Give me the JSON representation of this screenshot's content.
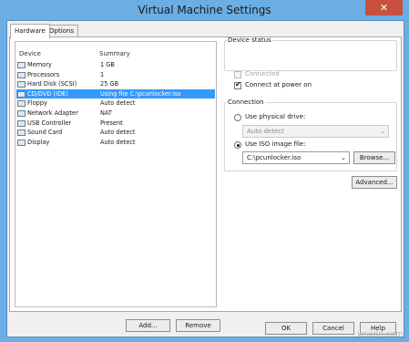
{
  "window": {
    "title": "Virtual Machine Settings",
    "close_glyph": "✕"
  },
  "tabs": [
    {
      "label": "Hardware",
      "active": true
    },
    {
      "label": "Options",
      "active": false
    }
  ],
  "device_list": {
    "headers": {
      "device": "Device",
      "summary": "Summary"
    },
    "rows": [
      {
        "device": "Memory",
        "summary": "1 GB",
        "icon": "memory-icon"
      },
      {
        "device": "Processors",
        "summary": "1",
        "icon": "processor-icon"
      },
      {
        "device": "Hard Disk (SCSI)",
        "summary": "25 GB",
        "icon": "hard-disk-icon"
      },
      {
        "device": "CD/DVD (IDE)",
        "summary": "Using file C:\\pcunlocker.iso",
        "icon": "cd-dvd-icon",
        "selected": true
      },
      {
        "device": "Floppy",
        "summary": "Auto detect",
        "icon": "floppy-icon"
      },
      {
        "device": "Network Adapter",
        "summary": "NAT",
        "icon": "network-adapter-icon"
      },
      {
        "device": "USB Controller",
        "summary": "Present",
        "icon": "usb-controller-icon"
      },
      {
        "device": "Sound Card",
        "summary": "Auto detect",
        "icon": "sound-card-icon"
      },
      {
        "device": "Display",
        "summary": "Auto detect",
        "icon": "display-icon"
      }
    ],
    "add_label": "Add...",
    "remove_label": "Remove"
  },
  "device_status": {
    "legend": "Device status",
    "connected_label": "Connected",
    "connected_checked": false,
    "connected_enabled": false,
    "connect_power_label": "Connect at power on",
    "connect_power_checked": true
  },
  "connection": {
    "legend": "Connection",
    "physical_label": "Use physical drive:",
    "physical_selected": false,
    "physical_value": "Auto detect",
    "iso_label": "Use ISO image file:",
    "iso_selected": true,
    "iso_value": "C:\\pcunlocker.iso",
    "browse_label": "Browse...",
    "advanced_label": "Advanced..."
  },
  "footer": {
    "ok_label": "OK",
    "cancel_label": "Cancel",
    "help_label": "Help"
  },
  "watermark": "wsxdn.com",
  "colors": {
    "accent": "#3399ff",
    "title_bar": "#6aaee4",
    "close": "#c7503f"
  }
}
